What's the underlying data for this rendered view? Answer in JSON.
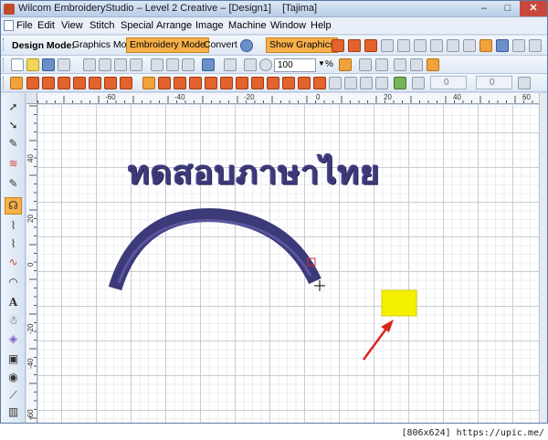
{
  "window": {
    "title": "Wilcom EmbroideryStudio – Level 2 Creative – [Design1",
    "title_suffix": "Tajima]",
    "min_label": "–",
    "max_label": "□",
    "close_label": "✕"
  },
  "menu": [
    "File",
    "Edit",
    "View",
    "Stitch",
    "Special",
    "Arrange",
    "Image",
    "Machine",
    "Window",
    "Help"
  ],
  "toolbar": {
    "design_mode_label": "Design Mode:",
    "graphics_mode": "Graphics Mode",
    "embroidery_mode": "Embroidery Mode",
    "convert": "Convert",
    "show_graphics": "Show Graphics",
    "zoom_value": "100",
    "zoom_unit": "%",
    "num_field_1": "0",
    "num_field_2": "0"
  },
  "rulers": {
    "top": [
      "-60",
      "-40",
      "-20",
      "0",
      "20",
      "40",
      "60"
    ],
    "left": [
      "40",
      "20",
      "0",
      "-20",
      "-40",
      "-60"
    ]
  },
  "canvas": {
    "thai_text": "ทดสอบภาษาไทย",
    "thread_color": "#3d3a7a",
    "selection_color": "#f5ef00",
    "arrow_color": "#d8261c"
  },
  "footer": {
    "watermark": "[806x624] https://upic.me/"
  }
}
